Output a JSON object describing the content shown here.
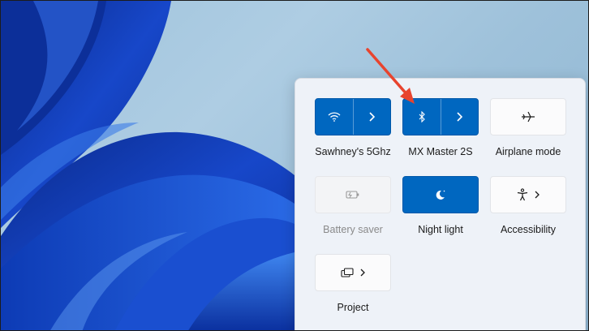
{
  "quick_settings": {
    "tiles": [
      {
        "id": "wifi",
        "label": "Sawhney's 5Ghz",
        "state": "on",
        "icon": "wifi-icon",
        "has_chevron": true
      },
      {
        "id": "bluetooth",
        "label": "MX Master 2S",
        "state": "on",
        "icon": "bluetooth-icon",
        "has_chevron": true
      },
      {
        "id": "airplane",
        "label": "Airplane mode",
        "state": "off",
        "icon": "airplane-icon",
        "has_chevron": false
      },
      {
        "id": "battery-saver",
        "label": "Battery saver",
        "state": "disabled",
        "icon": "battery-saver-icon",
        "has_chevron": false
      },
      {
        "id": "night-light",
        "label": "Night light",
        "state": "on",
        "icon": "night-light-icon",
        "has_chevron": false
      },
      {
        "id": "accessibility",
        "label": "Accessibility",
        "state": "off",
        "icon": "accessibility-icon",
        "has_chevron": true
      },
      {
        "id": "project",
        "label": "Project",
        "state": "off",
        "icon": "project-icon",
        "has_chevron": true
      }
    ]
  },
  "annotation": {
    "type": "arrow",
    "color": "#e8442e",
    "points_to": "bluetooth"
  },
  "colors": {
    "accent": "#0067c0",
    "panel": "#eef2f8"
  }
}
